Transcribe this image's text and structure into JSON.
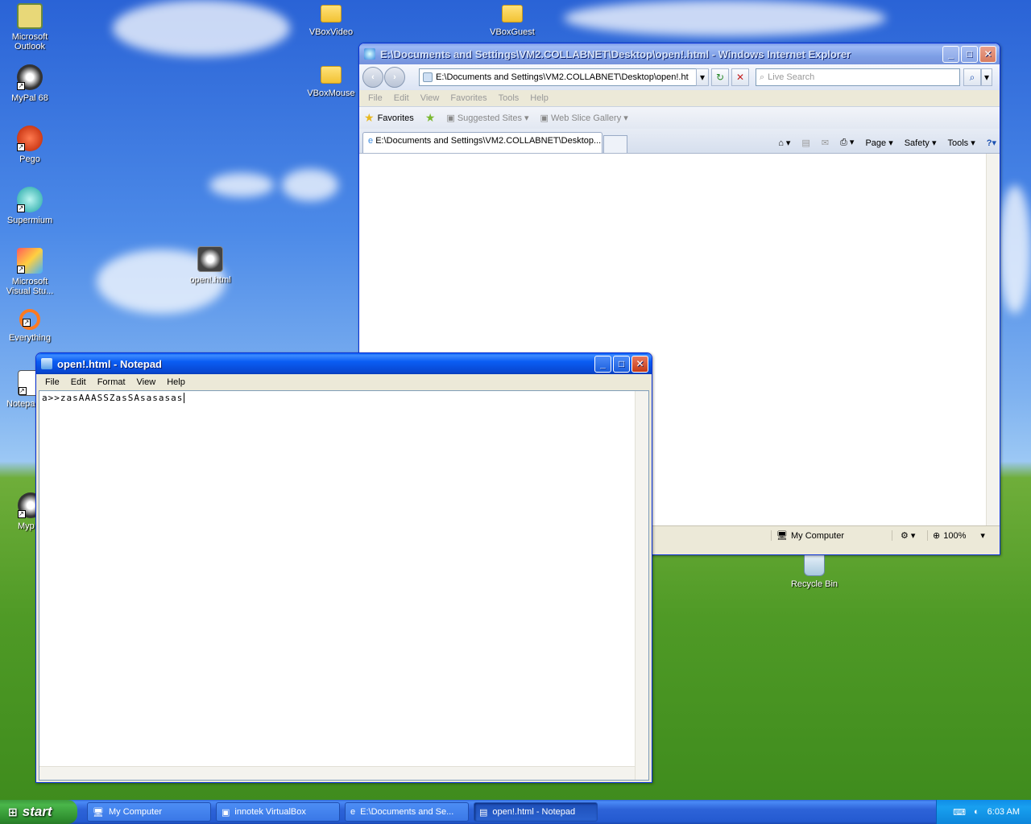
{
  "desktop": {
    "icons": [
      {
        "label": "Microsoft Outlook"
      },
      {
        "label": "MyPal 68"
      },
      {
        "label": "Pego"
      },
      {
        "label": "Supermium"
      },
      {
        "label": "Microsoft Visual Stu..."
      },
      {
        "label": "Everything"
      },
      {
        "label": "Notepa"
      },
      {
        "label": "Myp"
      },
      {
        "label": "VBoxVideo"
      },
      {
        "label": "VBoxMouse"
      },
      {
        "label": "VBoxGuest"
      },
      {
        "label": "open!.html"
      },
      {
        "label": "Recycle Bin"
      }
    ]
  },
  "ie": {
    "title": "E:\\Documents and Settings\\VM2.COLLABNET\\Desktop\\open!.html - Windows Internet Explorer",
    "menu": [
      "File",
      "Edit",
      "View",
      "Favorites",
      "Tools",
      "Help"
    ],
    "address": "E:\\Documents and Settings\\VM2.COLLABNET\\Desktop\\open!.ht",
    "search_placeholder": "Live Search",
    "favorites_label": "Favorites",
    "suggested_sites": "Suggested Sites",
    "web_slice_gallery": "Web Slice Gallery",
    "tab_title": "E:\\Documents and Settings\\VM2.COLLABNET\\Desktop...",
    "cmd_page": "Page",
    "cmd_safety": "Safety",
    "cmd_tools": "Tools",
    "status_zone": "My Computer",
    "zoom": "100%"
  },
  "notepad": {
    "title": "open!.html - Notepad",
    "menu": [
      "File",
      "Edit",
      "Format",
      "View",
      "Help"
    ],
    "text": "a>>zasAAASSZasSAsasasas"
  },
  "taskbar": {
    "start_label": "start",
    "tasks": [
      {
        "label": "My Computer"
      },
      {
        "label": "innotek VirtualBox"
      },
      {
        "label": "E:\\Documents and Se..."
      },
      {
        "label": "open!.html - Notepad"
      }
    ],
    "clock": "6:03 AM"
  },
  "colors": {
    "title_active": "#0a5df3",
    "title_inactive": "#7a9be8",
    "taskbar": "#245ad0",
    "start": "#3c9a3c"
  }
}
